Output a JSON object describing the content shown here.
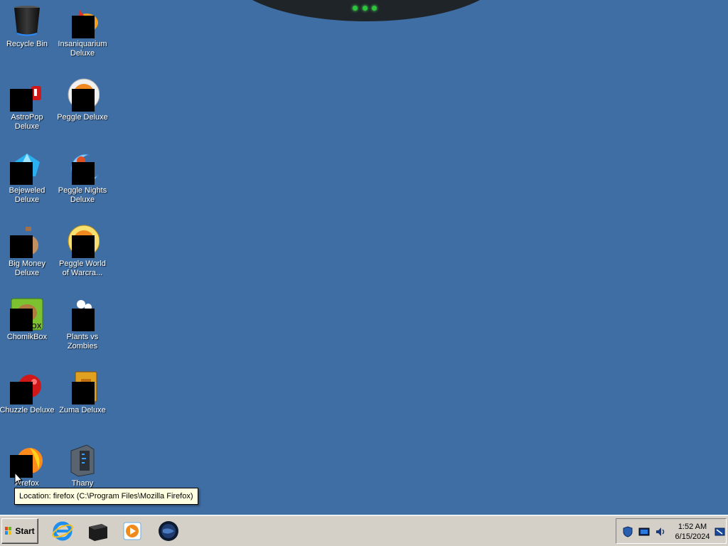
{
  "desktop": {
    "background": "#3f6ea4",
    "icons": [
      {
        "label": "Recycle Bin",
        "icon": "recycle-bin-icon"
      },
      {
        "label": "Insaniquarium Deluxe",
        "icon": "insaniquarium-icon"
      },
      {
        "label": "AstroPop Deluxe",
        "icon": "astropop-icon"
      },
      {
        "label": "Peggle Deluxe",
        "icon": "peggle-icon"
      },
      {
        "label": "Bejeweled Deluxe",
        "icon": "bejeweled-icon"
      },
      {
        "label": "Peggle Nights Deluxe",
        "icon": "peggle-nights-icon"
      },
      {
        "label": "Big Money Deluxe",
        "icon": "big-money-icon"
      },
      {
        "label": "Peggle World of Warcra...",
        "icon": "peggle-wow-icon"
      },
      {
        "label": "ChomikBox",
        "icon": "chomikbox-icon"
      },
      {
        "label": "Plants vs Zombies",
        "icon": "plants-vs-zombies-icon"
      },
      {
        "label": "Chuzzle Deluxe",
        "icon": "chuzzle-icon"
      },
      {
        "label": "Zuma Deluxe",
        "icon": "zuma-icon"
      },
      {
        "label": "Firefox",
        "icon": "firefox-icon"
      },
      {
        "label": "Thany",
        "icon": "thany-icon"
      }
    ]
  },
  "tooltip": {
    "text": "Location: firefox (C:\\Program Files\\Mozilla Firefox)"
  },
  "taskbar": {
    "start_label": "Start",
    "quick_launch": [
      "internet-explorer-icon",
      "media-center-icon",
      "media-player-icon",
      "globe-icon"
    ],
    "tray_icons": [
      "shield-icon",
      "display-icon",
      "volume-icon"
    ],
    "clock": {
      "time": "1:52 AM",
      "date": "6/15/2024"
    }
  }
}
